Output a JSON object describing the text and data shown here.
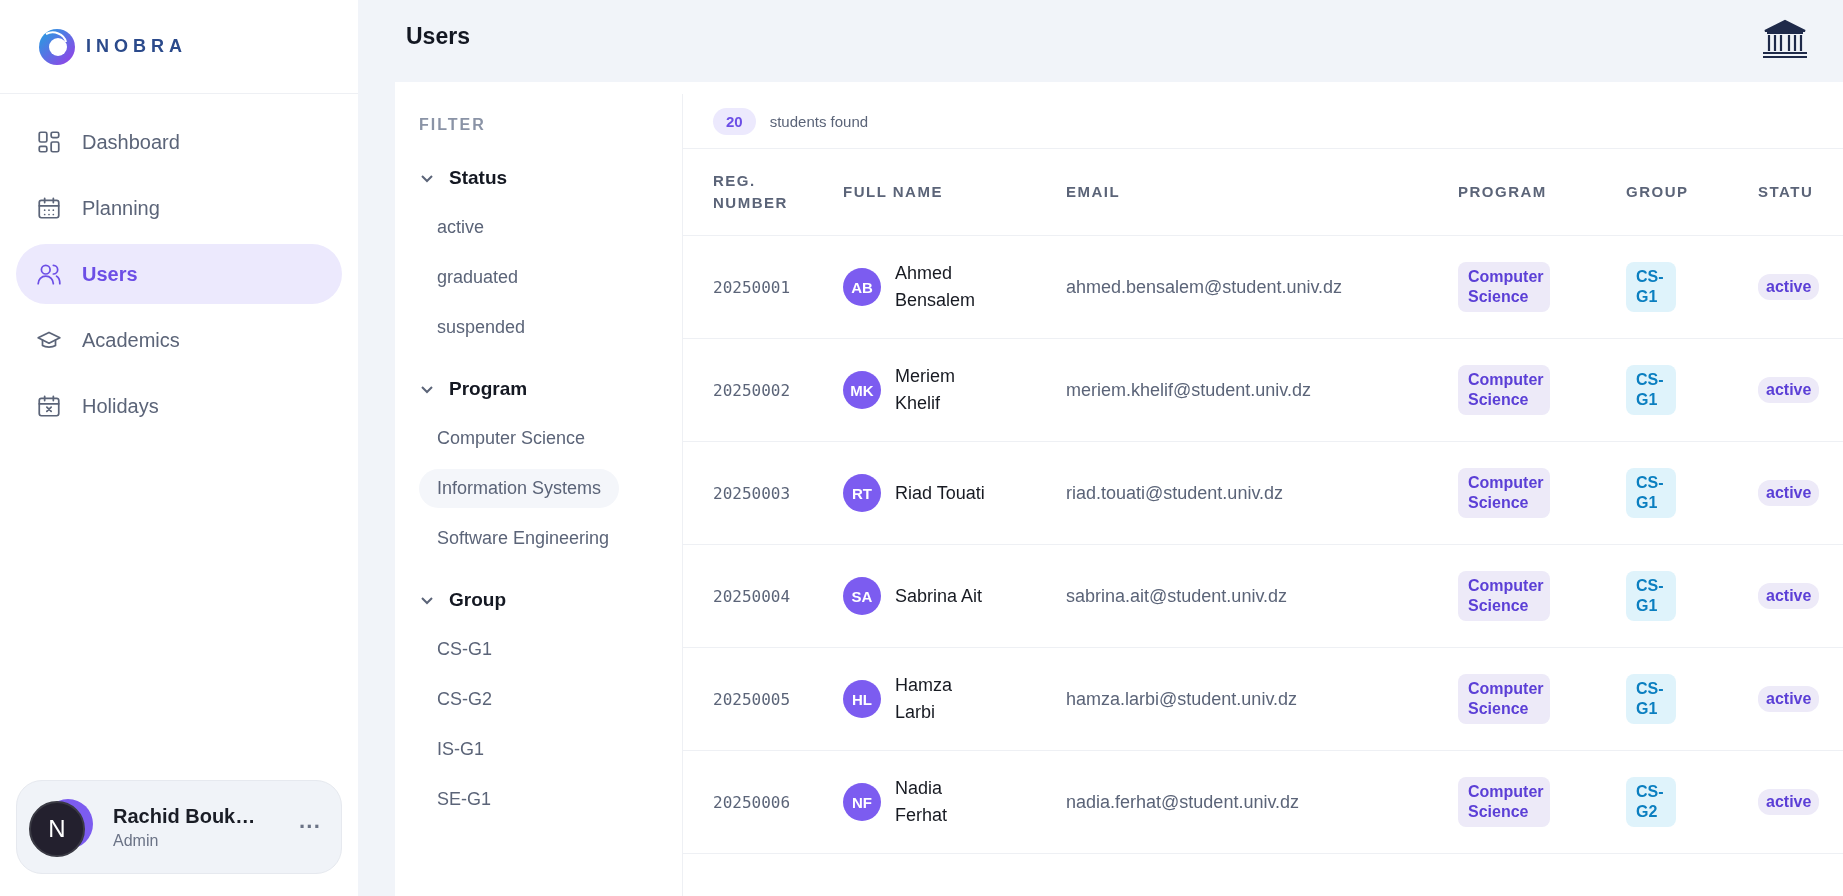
{
  "brand": {
    "name": "INOBRA"
  },
  "sidebar": {
    "items": [
      {
        "label": "Dashboard",
        "selected": false
      },
      {
        "label": "Planning",
        "selected": false
      },
      {
        "label": "Users",
        "selected": true
      },
      {
        "label": "Academics",
        "selected": false
      },
      {
        "label": "Holidays",
        "selected": false
      }
    ],
    "user": {
      "initial": "N",
      "name": "Rachid Bouk…",
      "role": "Admin",
      "menu": "···"
    }
  },
  "header": {
    "title": "Users"
  },
  "filter": {
    "title": "FILTER",
    "sections": [
      {
        "label": "Status",
        "expanded": true,
        "options": [
          {
            "label": "active",
            "selected": false
          },
          {
            "label": "graduated",
            "selected": false
          },
          {
            "label": "suspended",
            "selected": false
          }
        ]
      },
      {
        "label": "Program",
        "expanded": true,
        "options": [
          {
            "label": "Computer Science",
            "selected": false
          },
          {
            "label": "Information Systems",
            "selected": true
          },
          {
            "label": "Software Engineering",
            "selected": false
          }
        ]
      },
      {
        "label": "Group",
        "expanded": true,
        "options": [
          {
            "label": "CS-G1",
            "selected": false
          },
          {
            "label": "CS-G2",
            "selected": false
          },
          {
            "label": "IS-G1",
            "selected": false
          },
          {
            "label": "SE-G1",
            "selected": false
          }
        ]
      }
    ]
  },
  "results": {
    "count": "20",
    "label": "students found"
  },
  "table": {
    "columns": [
      "REG. NUMBER",
      "FULL NAME",
      "EMAIL",
      "PROGRAM",
      "GROUP",
      "STATU"
    ],
    "rows": [
      {
        "reg": "20250001",
        "initials": "AB",
        "name": "Ahmed Bensalem",
        "email": "ahmed.bensalem@student.univ.dz",
        "program": "Computer Science",
        "group": "CS-G1",
        "status": "active"
      },
      {
        "reg": "20250002",
        "initials": "MK",
        "name": "Meriem Khelif",
        "email": "meriem.khelif@student.univ.dz",
        "program": "Computer Science",
        "group": "CS-G1",
        "status": "active"
      },
      {
        "reg": "20250003",
        "initials": "RT",
        "name": "Riad Touati",
        "email": "riad.touati@student.univ.dz",
        "program": "Computer Science",
        "group": "CS-G1",
        "status": "active"
      },
      {
        "reg": "20250004",
        "initials": "SA",
        "name": "Sabrina Ait",
        "email": "sabrina.ait@student.univ.dz",
        "program": "Computer Science",
        "group": "CS-G1",
        "status": "active"
      },
      {
        "reg": "20250005",
        "initials": "HL",
        "name": "Hamza Larbi",
        "email": "hamza.larbi@student.univ.dz",
        "program": "Computer Science",
        "group": "CS-G1",
        "status": "active"
      },
      {
        "reg": "20250006",
        "initials": "NF",
        "name": "Nadia Ferhat",
        "email": "nadia.ferhat@student.univ.dz",
        "program": "Computer Science",
        "group": "CS-G2",
        "status": "active"
      }
    ]
  }
}
